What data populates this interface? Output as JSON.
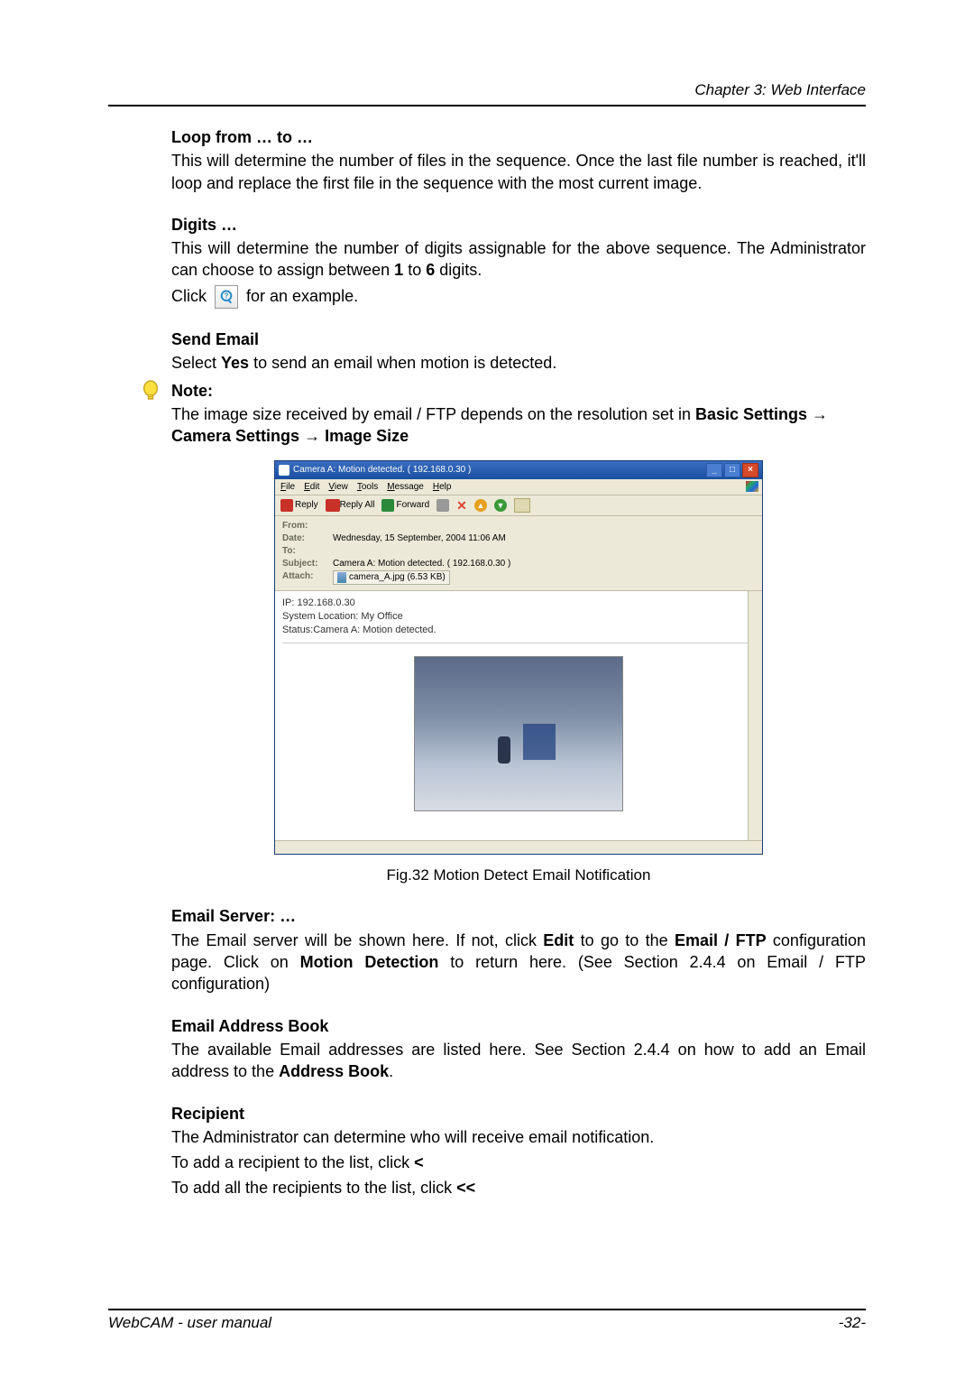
{
  "header": {
    "chapter": "Chapter 3: Web Interface"
  },
  "sections": {
    "loop": {
      "title": "Loop from … to …",
      "body": "This will determine the number of files in the sequence.  Once the last file number is reached, it'll loop and replace the first file in the sequence with the most current image."
    },
    "digits": {
      "title": "Digits …",
      "body_pre": "This will determine the number of digits assignable for the above sequence. The Administrator can choose to assign between ",
      "one": "1",
      "to": " to ",
      "six": "6",
      "body_post": " digits.",
      "click": "Click ",
      "example": " for an example."
    },
    "send_email": {
      "title": "Send Email",
      "body_pre": "Select ",
      "yes": "Yes",
      "body_post": " to send an email when motion is detected."
    },
    "note": {
      "title": "Note:",
      "line1": "The image size received by email / FTP depends on the resolution set in ",
      "path1": "Basic Settings",
      "arrow": " → ",
      "path2": "Camera Settings",
      "path3": "Image Size"
    },
    "figure_caption": "Fig.32  Motion Detect Email Notification",
    "email_server": {
      "title": "Email Server: …",
      "pre": "The Email server will be shown here.   If not, click ",
      "edit": "Edit",
      "mid1": " to go to the ",
      "emailftp": "Email / FTP",
      "mid2": " configuration page. Click on ",
      "md": "Motion Detection",
      "post": " to return here. (See Section 2.4.4 on Email / FTP configuration)"
    },
    "address_book": {
      "title": "Email Address Book",
      "pre": "The available Email addresses are listed here.  See Section 2.4.4 on how to add an Email address to the ",
      "ab": "Address Book",
      "post": "."
    },
    "recipient": {
      "title": "Recipient",
      "line1": "The Administrator can determine who will receive email notification.",
      "line2_pre": "To add a recipient to the list, click ",
      "lt": "<",
      "line3_pre": "To add all the recipients to the list, click ",
      "ltlt": "<<"
    }
  },
  "email_window": {
    "title": "Camera A: Motion detected. ( 192.168.0.30 )",
    "menus": [
      "File",
      "Edit",
      "View",
      "Tools",
      "Message",
      "Help"
    ],
    "toolbar": {
      "reply": "Reply",
      "reply_all": "Reply All",
      "forward": "Forward"
    },
    "headers": {
      "from_lbl": "From:",
      "from_val": "",
      "date_lbl": "Date:",
      "date_val": "Wednesday, 15 September, 2004 11:06 AM",
      "to_lbl": "To:",
      "to_val": "",
      "subject_lbl": "Subject:",
      "subject_val": "Camera A: Motion detected. ( 192.168.0.30 )",
      "attach_lbl": "Attach:",
      "attach_val": "camera_A.jpg (6.53 KB)"
    },
    "body": {
      "ip": "IP: 192.168.0.30",
      "loc": "System Location: My Office",
      "status": "Status:Camera A: Motion detected."
    }
  },
  "footer": {
    "left": "WebCAM - user manual",
    "right": "-32-"
  }
}
